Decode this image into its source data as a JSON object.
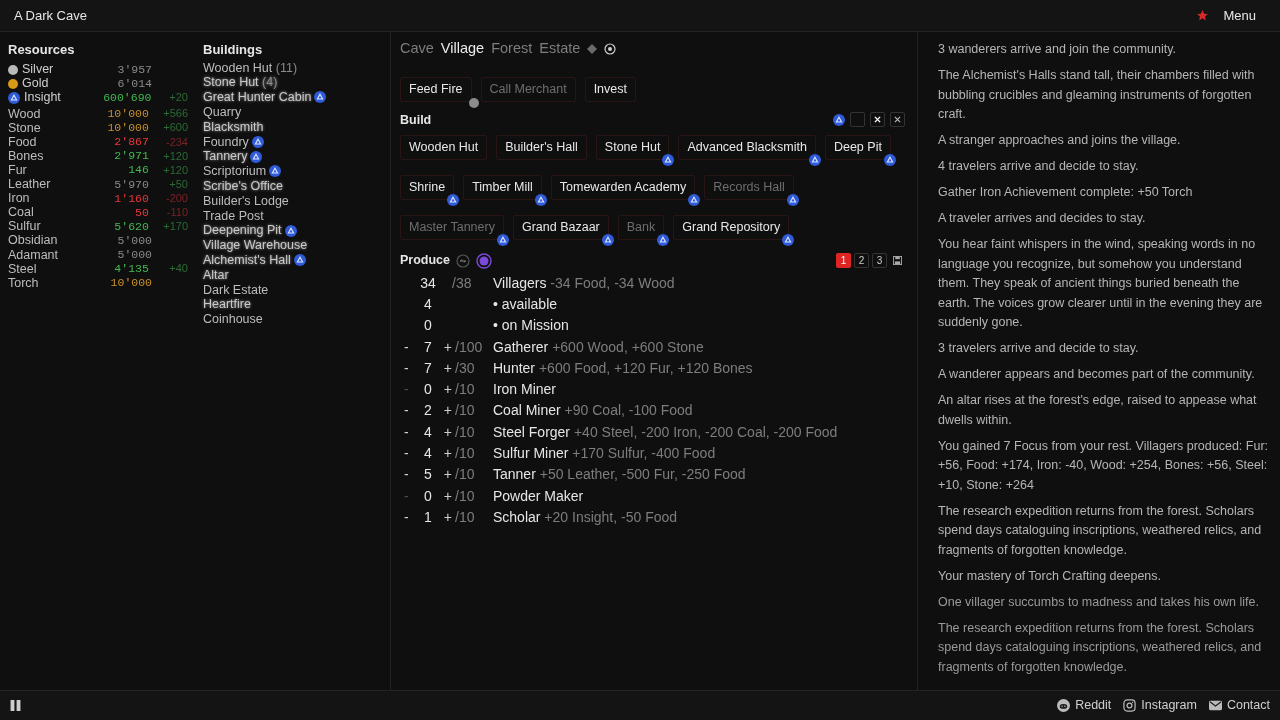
{
  "header": {
    "title": "A Dark Cave",
    "menu": "Menu"
  },
  "resources": {
    "title": "Resources",
    "items": [
      {
        "name": "Silver",
        "kind": "silver",
        "amount": {
          "text": "3'957",
          "color": "#8a8a8a"
        }
      },
      {
        "name": "Gold",
        "kind": "gold",
        "amount": {
          "text": "6'014",
          "color": "#8a8a8a"
        }
      },
      {
        "name": "Insight",
        "kind": "insight",
        "amount": {
          "text": "600'690",
          "color": "#3fb950"
        },
        "rate": {
          "text": "+20",
          "color": "#2b6b35"
        }
      },
      {
        "name": "Wood",
        "kind": "plain",
        "amount": {
          "text": "10'000",
          "color": "#c8902a"
        },
        "rate": {
          "text": "+566",
          "color": "#2b6b35"
        }
      },
      {
        "name": "Stone",
        "kind": "plain",
        "amount": {
          "text": "10'000",
          "color": "#c8902a"
        },
        "rate": {
          "text": "+600",
          "color": "#2b6b35"
        }
      },
      {
        "name": "Food",
        "kind": "plain",
        "amount": {
          "text": "2'867",
          "color": "#e5383b"
        },
        "rate": {
          "text": "-234",
          "color": "#7a2326"
        }
      },
      {
        "name": "Bones",
        "kind": "plain",
        "amount": {
          "text": "2'971",
          "color": "#3fb950"
        },
        "rate": {
          "text": "+120",
          "color": "#2b6b35"
        }
      },
      {
        "name": "Fur",
        "kind": "plain",
        "amount": {
          "text": "146",
          "color": "#3fb950"
        },
        "rate": {
          "text": "+120",
          "color": "#2b6b35"
        }
      },
      {
        "name": "Leather",
        "kind": "plain",
        "amount": {
          "text": "5'970",
          "color": "#8a8a8a"
        },
        "rate": {
          "text": "+50",
          "color": "#2b6b35"
        }
      },
      {
        "name": "Iron",
        "kind": "plain",
        "amount": {
          "text": "1'160",
          "color": "#e5383b"
        },
        "rate": {
          "text": "-200",
          "color": "#7a2326"
        }
      },
      {
        "name": "Coal",
        "kind": "plain",
        "amount": {
          "text": "50",
          "color": "#e5383b"
        },
        "rate": {
          "text": "-110",
          "color": "#7a2326"
        }
      },
      {
        "name": "Sulfur",
        "kind": "plain",
        "amount": {
          "text": "5'620",
          "color": "#3fb950"
        },
        "rate": {
          "text": "+170",
          "color": "#2b6b35"
        }
      },
      {
        "name": "Obsidian",
        "kind": "plain",
        "amount": {
          "text": "5'000",
          "color": "#8a8a8a"
        }
      },
      {
        "name": "Adamant",
        "kind": "plain",
        "amount": {
          "text": "5'000",
          "color": "#8a8a8a"
        }
      },
      {
        "name": "Steel",
        "kind": "plain",
        "amount": {
          "text": "4'135",
          "color": "#3fb950"
        },
        "rate": {
          "text": "+40",
          "color": "#2b6b35"
        }
      },
      {
        "name": "Torch",
        "kind": "plain",
        "amount": {
          "text": "10'000",
          "color": "#c8902a"
        }
      }
    ]
  },
  "buildings": {
    "title": "Buildings",
    "items": [
      {
        "name": "Wooden Hut",
        "count": "(11)",
        "glowing": false,
        "upgradable": false
      },
      {
        "name": "Stone Hut",
        "count": "(4)",
        "glowing": true,
        "upgradable": false
      },
      {
        "name": "Great Hunter Cabin",
        "glowing": true,
        "upgradable": true
      },
      {
        "name": "Quarry",
        "glowing": false,
        "upgradable": false
      },
      {
        "name": "Blacksmith",
        "glowing": true,
        "upgradable": false
      },
      {
        "name": "Foundry",
        "glowing": false,
        "upgradable": true
      },
      {
        "name": "Tannery",
        "glowing": true,
        "upgradable": true
      },
      {
        "name": "Scriptorium",
        "glowing": false,
        "upgradable": true
      },
      {
        "name": "Scribe's Office",
        "glowing": true,
        "upgradable": false
      },
      {
        "name": "Builder's Lodge",
        "glowing": false,
        "upgradable": false
      },
      {
        "name": "Trade Post",
        "glowing": false,
        "upgradable": false
      },
      {
        "name": "Deepening Pit",
        "glowing": true,
        "upgradable": true
      },
      {
        "name": "Village Warehouse",
        "glowing": true,
        "upgradable": false
      },
      {
        "name": "Alchemist's Hall",
        "glowing": true,
        "upgradable": true
      },
      {
        "name": "Altar",
        "glowing": true,
        "upgradable": false
      },
      {
        "name": "Dark Estate",
        "glowing": false,
        "upgradable": false
      },
      {
        "name": "Heartfire",
        "glowing": true,
        "upgradable": false
      },
      {
        "name": "Coinhouse",
        "glowing": false,
        "upgradable": false
      }
    ]
  },
  "tabs": [
    {
      "label": "Cave",
      "selected": false
    },
    {
      "label": "Village",
      "selected": true
    },
    {
      "label": "Forest",
      "selected": false
    },
    {
      "label": "Estate",
      "selected": false
    }
  ],
  "actions": [
    {
      "label": "Feed Fire",
      "disabled": false,
      "cooldown": true
    },
    {
      "label": "Call Merchant",
      "disabled": true,
      "cooldown": false
    },
    {
      "label": "Invest",
      "disabled": false,
      "cooldown": false
    }
  ],
  "build": {
    "title": "Build",
    "filter_checked": false,
    "items": [
      {
        "label": "Wooden Hut",
        "disabled": false,
        "upgradable": false
      },
      {
        "label": "Builder's Hall",
        "disabled": false,
        "upgradable": false
      },
      {
        "label": "Stone Hut",
        "disabled": false,
        "upgradable": true
      },
      {
        "label": "Advanced Blacksmith",
        "disabled": false,
        "upgradable": true
      },
      {
        "label": "Deep Pit",
        "disabled": false,
        "upgradable": true
      },
      {
        "label": "Shrine",
        "disabled": false,
        "upgradable": true
      },
      {
        "label": "Timber Mill",
        "disabled": false,
        "upgradable": true
      },
      {
        "label": "Tomewarden Academy",
        "disabled": false,
        "upgradable": true
      },
      {
        "label": "Records Hall",
        "disabled": true,
        "upgradable": true
      },
      {
        "label": "Master Tannery",
        "disabled": true,
        "upgradable": true
      },
      {
        "label": "Grand Bazaar",
        "disabled": false,
        "upgradable": true
      },
      {
        "label": "Bank",
        "disabled": true,
        "upgradable": true
      },
      {
        "label": "Grand Repository",
        "disabled": false,
        "upgradable": true
      }
    ]
  },
  "produce": {
    "title": "Produce",
    "pages": [
      {
        "label": "1",
        "selected": true
      },
      {
        "label": "2",
        "selected": false
      },
      {
        "label": "3",
        "selected": false
      }
    ],
    "summary": [
      {
        "count": "34",
        "cap": "/38",
        "label": "Villagers",
        "effects": "-34 Food, -34 Wood"
      },
      {
        "count": "4",
        "label": "• available"
      },
      {
        "count": "0",
        "label": "• on Mission"
      }
    ],
    "workers": [
      {
        "count": "7",
        "cap": "/100",
        "label": "Gatherer",
        "effects": "+600 Wood, +600 Stone",
        "can_remove": true
      },
      {
        "count": "7",
        "cap": "/30",
        "label": "Hunter",
        "effects": "+600 Food, +120 Fur, +120 Bones",
        "can_remove": true
      },
      {
        "count": "0",
        "cap": "/10",
        "label": "Iron Miner",
        "can_remove": false
      },
      {
        "count": "2",
        "cap": "/10",
        "label": "Coal Miner",
        "effects": "+90 Coal, -100 Food",
        "can_remove": true
      },
      {
        "count": "4",
        "cap": "/10",
        "label": "Steel Forger",
        "effects": "+40 Steel, -200 Iron, -200 Coal, -200 Food",
        "can_remove": true
      },
      {
        "count": "4",
        "cap": "/10",
        "label": "Sulfur Miner",
        "effects": "+170 Sulfur, -400 Food",
        "can_remove": true
      },
      {
        "count": "5",
        "cap": "/10",
        "label": "Tanner",
        "effects": "+50 Leather, -500 Fur, -250 Food",
        "can_remove": true
      },
      {
        "count": "0",
        "cap": "/10",
        "label": "Powder Maker",
        "can_remove": false
      },
      {
        "count": "1",
        "cap": "/10",
        "label": "Scholar",
        "effects": "+20 Insight, -50 Food",
        "can_remove": true
      }
    ],
    "minus": "-",
    "plus": "+"
  },
  "log": [
    "3 wanderers arrive and join the community.",
    "The Alchemist's Halls stand tall, their chambers filled with bubbling crucibles and gleaming instruments of forgotten craft.",
    "A stranger approaches and joins the village.",
    "4 travelers arrive and decide to stay.",
    "Gather Iron Achievement complete: +50 Torch",
    "A traveler arrives and decides to stay.",
    "You hear faint whispers in the wind, speaking words in no language you recognize, but somehow you understand them. They speak of ancient things buried beneath the earth. The voices grow clearer until in the evening they are suddenly gone.",
    "3 travelers arrive and decide to stay.",
    "A wanderer appears and becomes part of the community.",
    "An altar rises at the forest's edge, raised to appease what dwells within.",
    "You gained 7 Focus from your rest. Villagers produced: Fur: +56, Food: +174, Iron: -40, Wood: +254, Bones: +56, Steel: +10, Stone: +264",
    "The research expedition returns from the forest. Scholars spend days cataloguing inscriptions, weathered relics, and fragments of forgotten knowledge.",
    "Your mastery of Torch Crafting deepens.",
    "One villager succumbs to madness and takes his own life.",
    "The research expedition returns from the forest. Scholars spend days cataloguing inscriptions, weathered relics, and fragments of forgotten knowledge."
  ],
  "footer": {
    "links": [
      {
        "kind": "reddit",
        "label": "Reddit"
      },
      {
        "kind": "instagram",
        "label": "Instagram"
      },
      {
        "kind": "mail",
        "label": "Contact"
      }
    ]
  }
}
